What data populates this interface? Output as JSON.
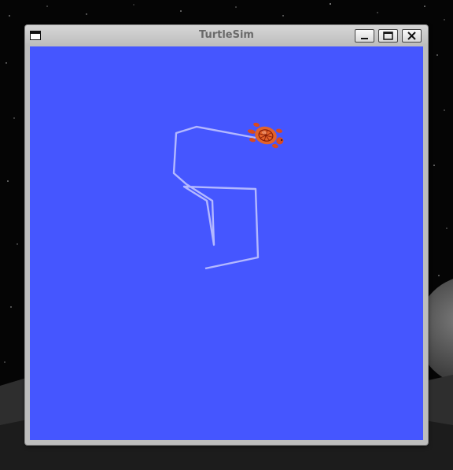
{
  "window": {
    "title": "TurtleSim"
  },
  "canvas": {
    "background_color": "#4556ff",
    "pen_color": "#b3b8ff"
  },
  "turtle": {
    "color": "#d84a1f",
    "shell_color": "#e2622a"
  },
  "icons": {
    "window_menu": "window-menu-icon",
    "minimize": "minimize-icon",
    "maximize": "maximize-icon",
    "close": "close-icon"
  }
}
